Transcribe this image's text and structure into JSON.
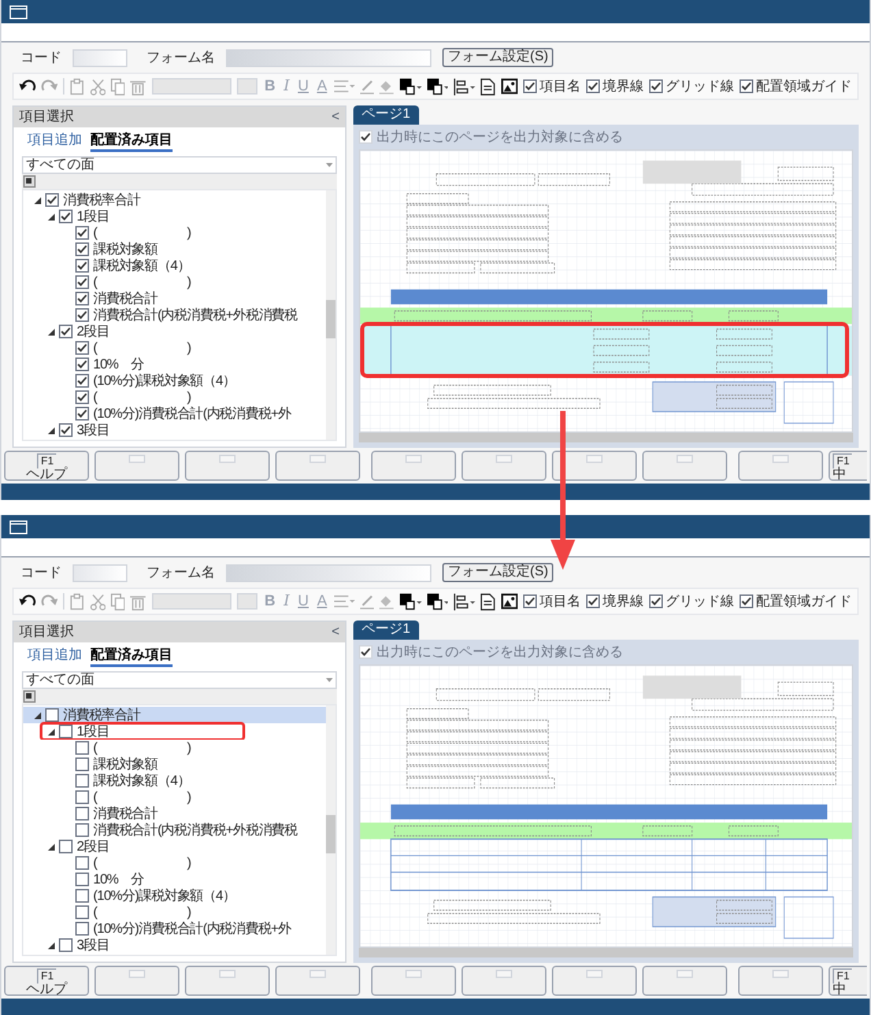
{
  "screens": [
    {
      "code_label": "コード",
      "form_name_label": "フォーム名",
      "form_settings_button": "フォーム設定(S)",
      "format_buttons": [
        "B",
        "I",
        "U",
        "A"
      ],
      "toolbar_checkboxes": [
        {
          "label": "項目名",
          "checked": true
        },
        {
          "label": "境界線",
          "checked": true
        },
        {
          "label": "グリッド線",
          "checked": true
        },
        {
          "label": "配置領域ガイド",
          "checked": true
        }
      ],
      "side_panel": {
        "title": "項目選択",
        "collapse": "<",
        "tabs": [
          {
            "label": "項目追加",
            "selected": false
          },
          {
            "label": "配置済み項目",
            "selected": true
          }
        ],
        "filter": "すべての面",
        "tree": [
          {
            "label": "消費税率合計",
            "checked": true,
            "selected": false,
            "expanded": true,
            "children": [
              {
                "label": "1段目",
                "checked": true,
                "selected": false,
                "highlighted": false,
                "expanded": true,
                "children": [
                  {
                    "label": "(　　　　　　　)",
                    "checked": true,
                    "selected": false
                  },
                  {
                    "label": "課税対象額",
                    "checked": true,
                    "selected": false
                  },
                  {
                    "label": "課税対象額（4）",
                    "checked": true,
                    "selected": false
                  },
                  {
                    "label": "(　　　　　　　)",
                    "checked": true,
                    "selected": false
                  },
                  {
                    "label": "消費税合計",
                    "checked": true,
                    "selected": false
                  },
                  {
                    "label": "消費税合計(内税消費税+外税消費税",
                    "checked": true,
                    "selected": false
                  }
                ]
              },
              {
                "label": "2段目",
                "checked": true,
                "selected": false,
                "highlighted": false,
                "expanded": true,
                "children": [
                  {
                    "label": "(　　　　　　　)",
                    "checked": true,
                    "selected": false
                  },
                  {
                    "label": "10%　分",
                    "checked": true,
                    "selected": false
                  },
                  {
                    "label": "(10%分)課税対象額（4）",
                    "checked": true,
                    "selected": false
                  },
                  {
                    "label": "(　　　　　　　)",
                    "checked": true,
                    "selected": false
                  },
                  {
                    "label": "(10%分)消費税合計(内税消費税+外",
                    "checked": true,
                    "selected": false
                  }
                ]
              },
              {
                "label": "3段目",
                "checked": true,
                "selected": false,
                "highlighted": false,
                "expanded": true
              }
            ]
          }
        ]
      },
      "page_tabs": [
        {
          "label": "ページ1",
          "selected": true
        }
      ],
      "include_page": {
        "label": "出力時にこのページを出力対象に含める",
        "checked": true,
        "disabled": true
      },
      "canvas": {
        "tax_rows_placed": true,
        "highlighted": true
      },
      "function_keys": [
        {
          "kind": "key",
          "key": "F1",
          "label": "ヘルプ"
        },
        {
          "kind": "blank"
        },
        {
          "kind": "blank"
        },
        {
          "kind": "blank"
        },
        {
          "kind": "blank"
        },
        {
          "kind": "blank"
        },
        {
          "kind": "blank"
        },
        {
          "kind": "blank"
        },
        {
          "kind": "blank"
        },
        {
          "kind": "key",
          "key": "F1",
          "label": "中"
        }
      ]
    },
    {
      "code_label": "コード",
      "form_name_label": "フォーム名",
      "form_settings_button": "フォーム設定(S)",
      "format_buttons": [
        "B",
        "I",
        "U",
        "A"
      ],
      "toolbar_checkboxes": [
        {
          "label": "項目名",
          "checked": true
        },
        {
          "label": "境界線",
          "checked": true
        },
        {
          "label": "グリッド線",
          "checked": true
        },
        {
          "label": "配置領域ガイド",
          "checked": true
        }
      ],
      "side_panel": {
        "title": "項目選択",
        "collapse": "<",
        "tabs": [
          {
            "label": "項目追加",
            "selected": false
          },
          {
            "label": "配置済み項目",
            "selected": true
          }
        ],
        "filter": "すべての面",
        "tree": [
          {
            "label": "消費税率合計",
            "checked": false,
            "selected": true,
            "expanded": true,
            "children": [
              {
                "label": "1段目",
                "checked": false,
                "selected": false,
                "highlighted": true,
                "expanded": true,
                "children": [
                  {
                    "label": "(　　　　　　　)",
                    "checked": false,
                    "selected": false
                  },
                  {
                    "label": "課税対象額",
                    "checked": false,
                    "selected": false
                  },
                  {
                    "label": "課税対象額（4）",
                    "checked": false,
                    "selected": false
                  },
                  {
                    "label": "(　　　　　　　)",
                    "checked": false,
                    "selected": false
                  },
                  {
                    "label": "消費税合計",
                    "checked": false,
                    "selected": false
                  },
                  {
                    "label": "消費税合計(内税消費税+外税消費税",
                    "checked": false,
                    "selected": false
                  }
                ]
              },
              {
                "label": "2段目",
                "checked": false,
                "selected": false,
                "highlighted": false,
                "expanded": true,
                "children": [
                  {
                    "label": "(　　　　　　　)",
                    "checked": false,
                    "selected": false
                  },
                  {
                    "label": "10%　分",
                    "checked": false,
                    "selected": false
                  },
                  {
                    "label": "(10%分)課税対象額（4）",
                    "checked": false,
                    "selected": false
                  },
                  {
                    "label": "(　　　　　　　)",
                    "checked": false,
                    "selected": false
                  },
                  {
                    "label": "(10%分)消費税合計(内税消費税+外",
                    "checked": false,
                    "selected": false
                  }
                ]
              },
              {
                "label": "3段目",
                "checked": false,
                "selected": false,
                "highlighted": false,
                "expanded": true
              }
            ]
          }
        ]
      },
      "page_tabs": [
        {
          "label": "ページ1",
          "selected": true
        }
      ],
      "include_page": {
        "label": "出力時にこのページを出力対象に含める",
        "checked": true,
        "disabled": true
      },
      "canvas": {
        "tax_rows_placed": false,
        "highlighted": false
      },
      "function_keys": [
        {
          "kind": "key",
          "key": "F1",
          "label": "ヘルプ"
        },
        {
          "kind": "blank"
        },
        {
          "kind": "blank"
        },
        {
          "kind": "blank"
        },
        {
          "kind": "blank"
        },
        {
          "kind": "blank"
        },
        {
          "kind": "blank"
        },
        {
          "kind": "blank"
        },
        {
          "kind": "blank"
        },
        {
          "kind": "key",
          "key": "F1",
          "label": "中"
        }
      ]
    }
  ]
}
